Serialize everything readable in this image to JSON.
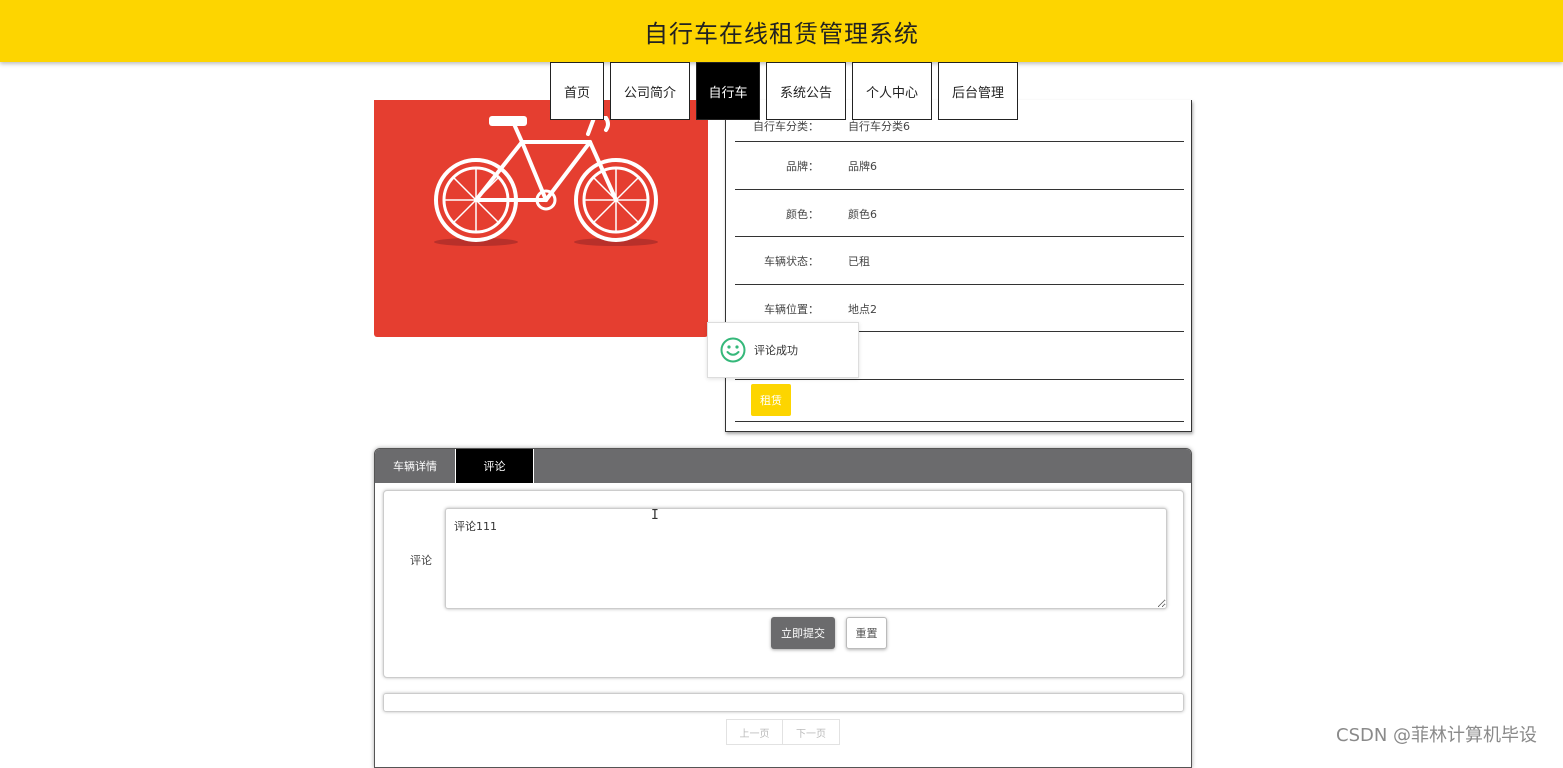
{
  "header": {
    "title": "自行车在线租赁管理系统"
  },
  "nav": {
    "items": [
      {
        "label": "首页"
      },
      {
        "label": "公司简介"
      },
      {
        "label": "自行车"
      },
      {
        "label": "系统公告"
      },
      {
        "label": "个人中心"
      },
      {
        "label": "后台管理"
      }
    ]
  },
  "product": {
    "image_icon": "bicycle-image",
    "fields": [
      {
        "label": "自行车分类：",
        "value": "自行车分类6"
      },
      {
        "label": "品牌：",
        "value": "品牌6"
      },
      {
        "label": "颜色：",
        "value": "颜色6"
      },
      {
        "label": "车辆状态：",
        "value": "已租"
      },
      {
        "label": "车辆位置：",
        "value": "地点2"
      }
    ],
    "rent_button": "租赁"
  },
  "toast": {
    "icon": "smile-icon",
    "message": "评论成功"
  },
  "tabs": {
    "items": [
      {
        "label": "车辆详情"
      },
      {
        "label": "评论"
      }
    ]
  },
  "comment_form": {
    "label": "评论",
    "value": "评论111",
    "submit": "立即提交",
    "reset": "重置"
  },
  "pagination": {
    "prev": "上一页",
    "next": "下一页"
  },
  "watermark": "CSDN @菲林计算机毕设",
  "colors": {
    "accent": "#fdd500",
    "nav_active": "#000000",
    "tab_bar": "#6b6b6d",
    "image_bg": "#e53e30"
  }
}
